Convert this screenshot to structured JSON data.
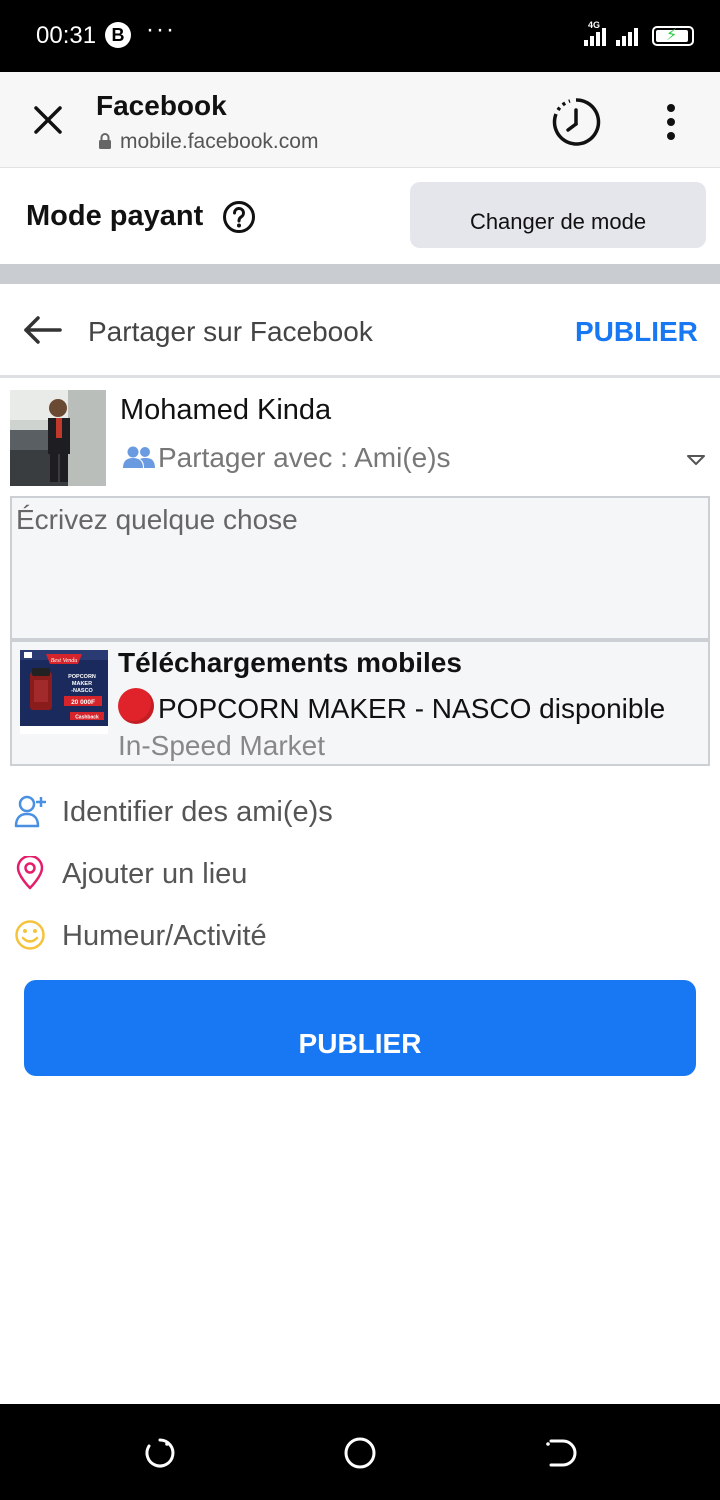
{
  "status_bar": {
    "time": "00:31",
    "badge": "B",
    "more_dots": "···",
    "network": "4G"
  },
  "browser": {
    "title": "Facebook",
    "url": "mobile.facebook.com",
    "icons": [
      "close-icon",
      "lock-icon",
      "history-icon",
      "more-vert-icon"
    ]
  },
  "mode": {
    "label": "Mode payant",
    "change_button": "Changer de mode"
  },
  "share_header": {
    "title": "Partager sur Facebook",
    "publish_label": "PUBLIER"
  },
  "author": {
    "name": "Mohamed Kinda",
    "audience_prefix": "Partager avec : ",
    "audience_value": "Ami(e)s"
  },
  "composer": {
    "placeholder": "Écrivez quelque chose"
  },
  "link_card": {
    "title": "Téléchargements mobiles",
    "description": "POPCORN MAKER - NASCO disponible",
    "source": "In-Speed Market",
    "thumb": {
      "headline": "Best Vendu",
      "line1": "POPCORN",
      "line2": "MAKER",
      "line3": "-NASCO",
      "price": "20 000F",
      "cashback": "Cashback"
    }
  },
  "options": [
    {
      "label": "Identifier des ami(e)s",
      "icon": "tag-friends-icon"
    },
    {
      "label": "Ajouter un lieu",
      "icon": "location-pin-icon"
    },
    {
      "label": "Humeur/Activité",
      "icon": "smiley-icon"
    }
  ],
  "publish_button": "PUBLIER",
  "colors": {
    "accent": "#1877f2",
    "location": "#e41e6b",
    "smiley": "#f5c33b",
    "tag": "#4a90e2"
  }
}
